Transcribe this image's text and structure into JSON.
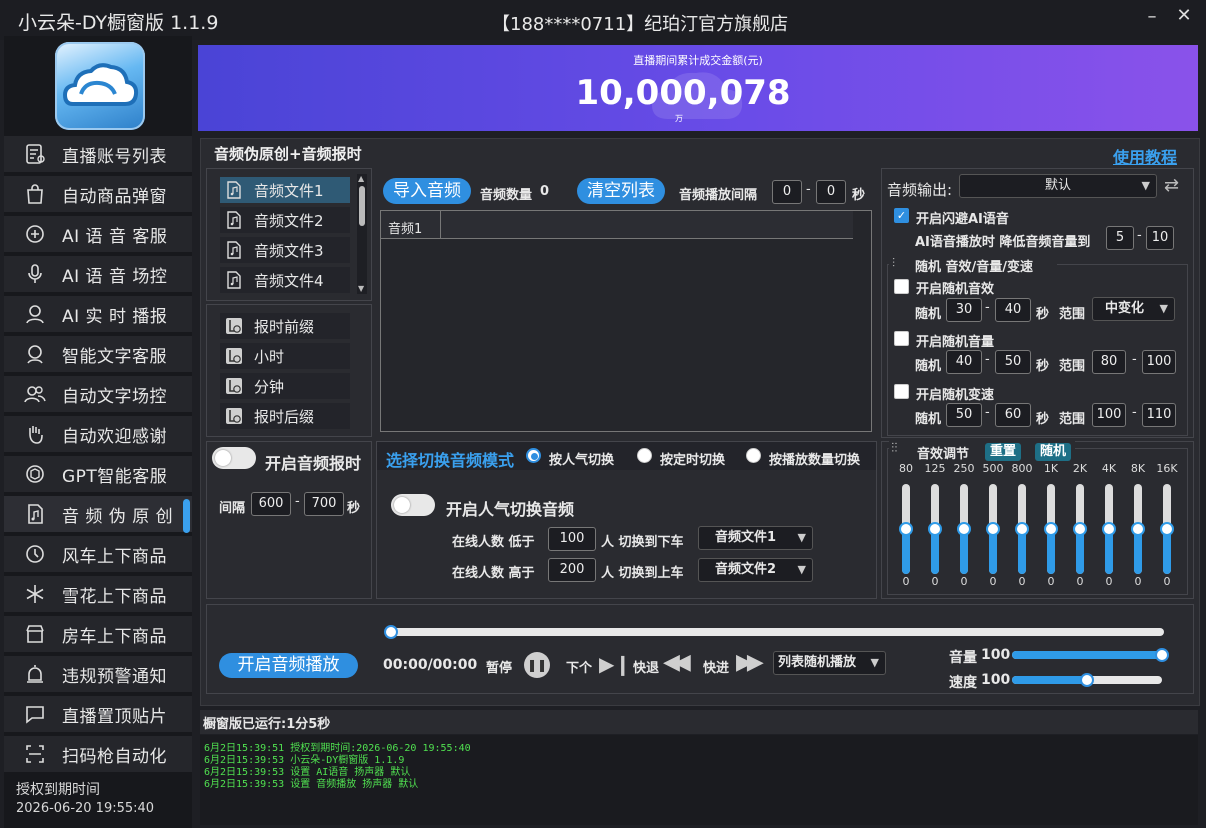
{
  "window": {
    "app_title": "小云朵-DY橱窗版 1.1.9",
    "store_title": "【188****0711】纪珀汀官方旗舰店",
    "minimize": "–",
    "close": "✕"
  },
  "sidebar": {
    "items": [
      {
        "label": "直播账号列表",
        "icon": "account-list-icon"
      },
      {
        "label": "自动商品弹窗",
        "icon": "shopping-bag-icon"
      },
      {
        "label": "AI 语 音 客服",
        "icon": "ai-voice-service-icon"
      },
      {
        "label": "AI 语 音 场控",
        "icon": "microphone-icon"
      },
      {
        "label": "AI 实 时 播报",
        "icon": "ai-broadcaster-icon"
      },
      {
        "label": "智能文字客服",
        "icon": "text-service-icon"
      },
      {
        "label": "自动文字场控",
        "icon": "users-icon"
      },
      {
        "label": "自动欢迎感谢",
        "icon": "welcome-hand-icon"
      },
      {
        "label": "GPT智能客服",
        "icon": "gpt-icon"
      },
      {
        "label": "音 频 伪 原 创",
        "icon": "audio-file-icon"
      },
      {
        "label": "风车上下商品",
        "icon": "windmill-icon"
      },
      {
        "label": "雪花上下商品",
        "icon": "snowflake-icon"
      },
      {
        "label": "房车上下商品",
        "icon": "store-icon"
      },
      {
        "label": "违规预警通知",
        "icon": "alarm-icon"
      },
      {
        "label": "直播置顶贴片",
        "icon": "pin-message-icon"
      },
      {
        "label": "扫码枪自动化",
        "icon": "scan-icon"
      }
    ],
    "active_index": 9,
    "auth_label": "授权到期时间",
    "auth_date": "2026-06-20 19:55:40"
  },
  "banner": {
    "label": "直播期间累计成交金额(元)",
    "value": "10,000,078",
    "unit": "万"
  },
  "section": {
    "title": "音频伪原创+音频报时",
    "tutorial_link": "使用教程"
  },
  "audio_files": [
    "音频文件1",
    "音频文件2",
    "音频文件3",
    "音频文件4"
  ],
  "time_segments": [
    "报时前缀",
    "小时",
    "分钟",
    "报时后缀"
  ],
  "import": {
    "import_button": "导入音频",
    "count_label": "音频数量",
    "count_value": "0",
    "clear_button": "清空列表",
    "interval_label": "音频播放间隔",
    "interval_from": "0",
    "interval_to": "0",
    "interval_unit": "秒",
    "table_header": "音频1"
  },
  "time_report": {
    "toggle_label": "开启音频报时",
    "interval_label": "间隔",
    "from": "600",
    "to": "700",
    "unit": "秒"
  },
  "switch_mode": {
    "title": "选择切换音频模式",
    "options": [
      "按人气切换",
      "按定时切换",
      "按播放数量切换"
    ],
    "selected": 0,
    "toggle_label": "开启人气切换音频",
    "rule_low": {
      "prefix": "在线人数 低于",
      "value": "100",
      "suffix": "人 切换到下车",
      "target": "音频文件1"
    },
    "rule_high": {
      "prefix": "在线人数 高于",
      "value": "200",
      "suffix": "人 切换到上车",
      "target": "音频文件2"
    }
  },
  "output": {
    "label": "音频输出:",
    "device": "默认",
    "ai_dodge_label": "开启闪避AI语音",
    "ai_dodge_checked": true,
    "ai_volume_label": "AI语音播放时 降低音频音量到",
    "ai_volume_from": "5",
    "ai_volume_to": "10",
    "random_group_title": "随机 音效/音量/变速",
    "random_effect": {
      "label": "开启随机音效",
      "prefix": "随机",
      "from": "30",
      "to": "40",
      "unit": "秒",
      "range_label": "范围",
      "range_select": "中变化"
    },
    "random_volume": {
      "label": "开启随机音量",
      "prefix": "随机",
      "from": "40",
      "to": "50",
      "unit": "秒",
      "range_label": "范围",
      "range_from": "80",
      "range_to": "100"
    },
    "random_speed": {
      "label": "开启随机变速",
      "prefix": "随机",
      "from": "50",
      "to": "60",
      "unit": "秒",
      "range_label": "范围",
      "range_from": "100",
      "range_to": "110"
    }
  },
  "equalizer": {
    "title": "音效调节",
    "reset_label": "重置",
    "random_label": "随机",
    "bands": [
      {
        "freq": "80",
        "gain": "0"
      },
      {
        "freq": "125",
        "gain": "0"
      },
      {
        "freq": "250",
        "gain": "0"
      },
      {
        "freq": "500",
        "gain": "0"
      },
      {
        "freq": "800",
        "gain": "0"
      },
      {
        "freq": "1K",
        "gain": "0"
      },
      {
        "freq": "2K",
        "gain": "0"
      },
      {
        "freq": "4K",
        "gain": "0"
      },
      {
        "freq": "8K",
        "gain": "0"
      },
      {
        "freq": "16K",
        "gain": "0"
      }
    ],
    "level_fraction": 0.5
  },
  "player": {
    "start_button": "开启音频播放",
    "time": "00:00/00:00",
    "pause_label": "暂停",
    "next_label": "下个",
    "rewind_label": "快退",
    "forward_label": "快进",
    "mode_select": "列表随机播放",
    "volume_label": "音量",
    "volume_value": "100",
    "speed_label": "速度",
    "speed_value": "100",
    "progress_fraction": 0,
    "volume_fraction": 1.0,
    "speed_fraction": 0.5
  },
  "log": {
    "header": "橱窗版已运行:1分5秒",
    "lines": [
      "6月2日15:39:51 授权到期时间:2026-06-20 19:55:40",
      "6月2日15:39:53 小云朵-DY橱窗版 1.1.9",
      "6月2日15:39:53 设置 AI语音 扬声器 默认",
      "6月2日15:39:53 设置 音频播放 扬声器 默认"
    ]
  },
  "colors": {
    "accent": "#2f8fe0",
    "banner_start": "#4a44d6",
    "banner_end": "#8a52ea",
    "log_text": "#50e050"
  }
}
